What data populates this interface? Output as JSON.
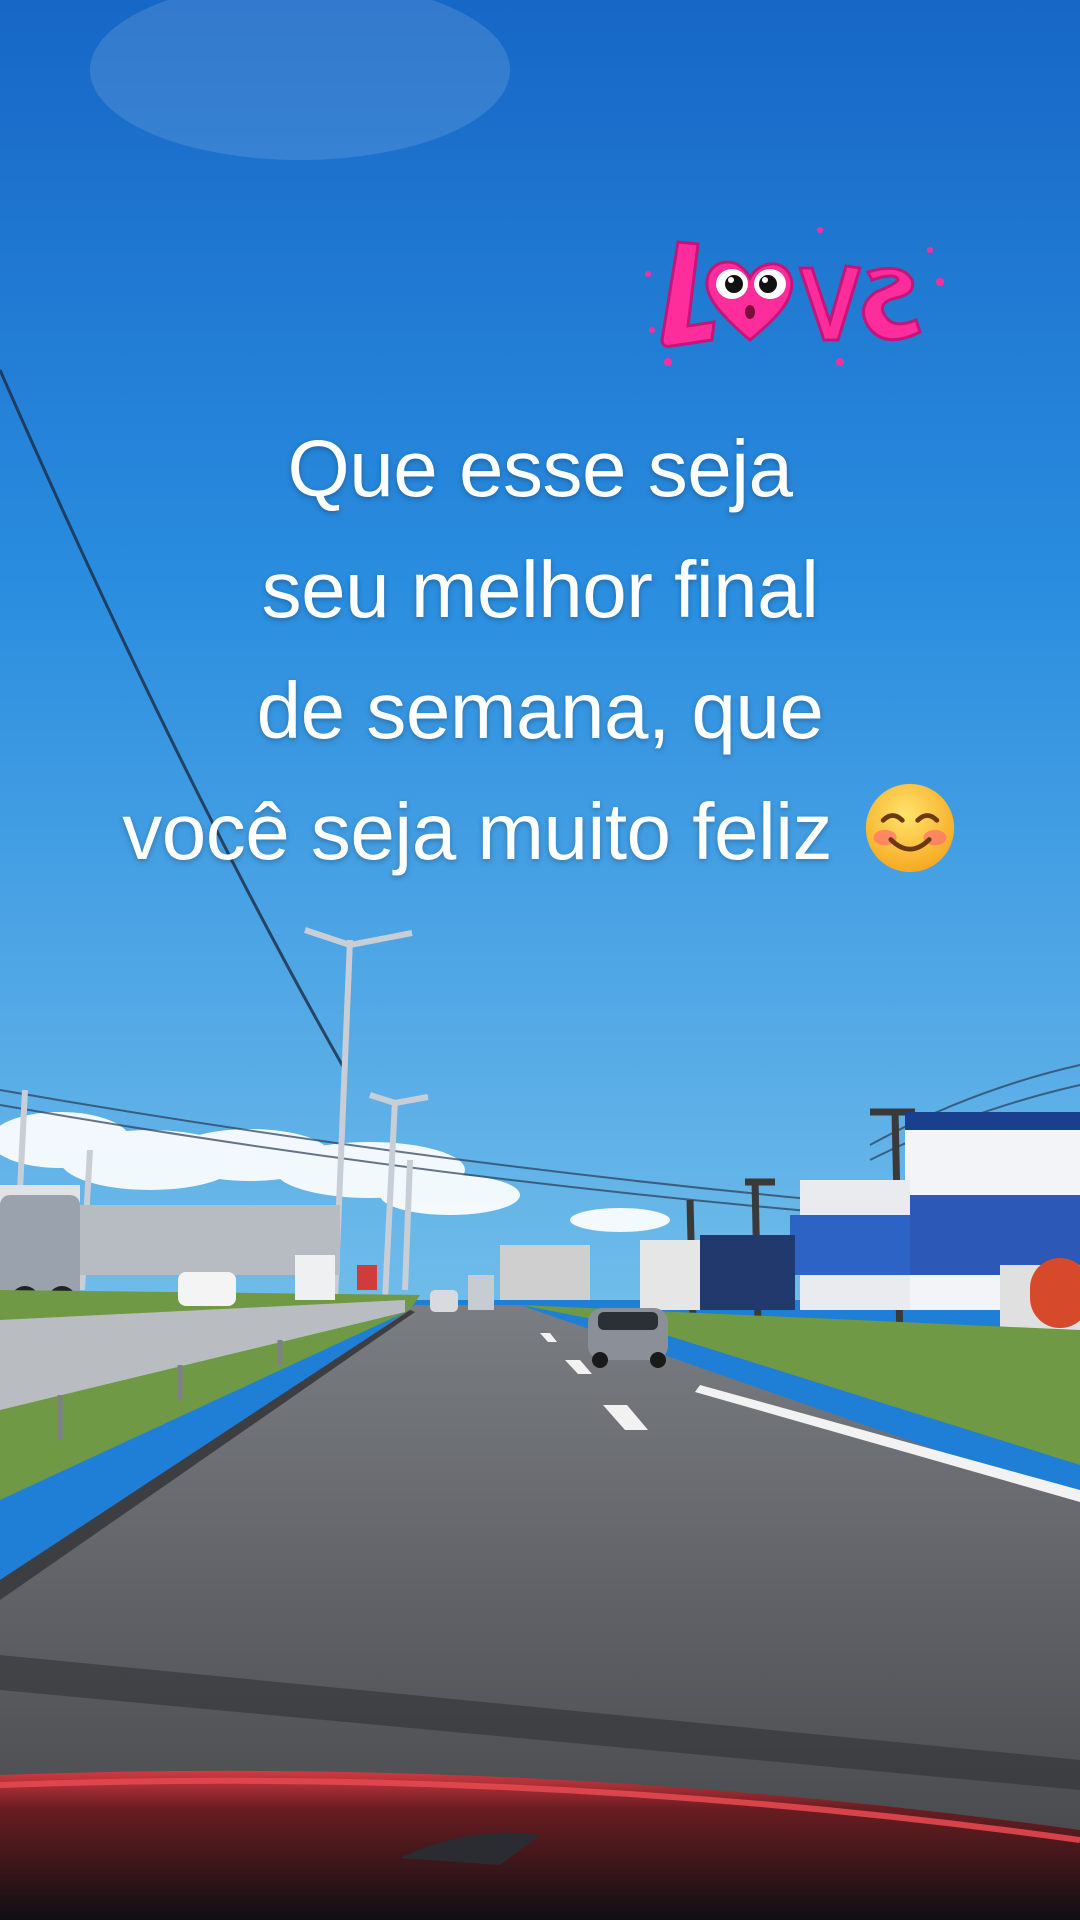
{
  "caption": {
    "lines": [
      "Que esse seja",
      "seu melhor final",
      "de semana, que",
      "você seja muito feliz"
    ],
    "emoji": "smiling-face-with-blush-emoji"
  },
  "sticker": {
    "text": "Love",
    "icon": "love-sticker-icon",
    "color": "#ff2d9b"
  },
  "colors": {
    "sky_top": "#1668c7",
    "sky_bottom": "#5fb3ea",
    "road": "#5b5e63",
    "grass": "#6e9a3e",
    "dashboard_red": "#c8313a"
  }
}
